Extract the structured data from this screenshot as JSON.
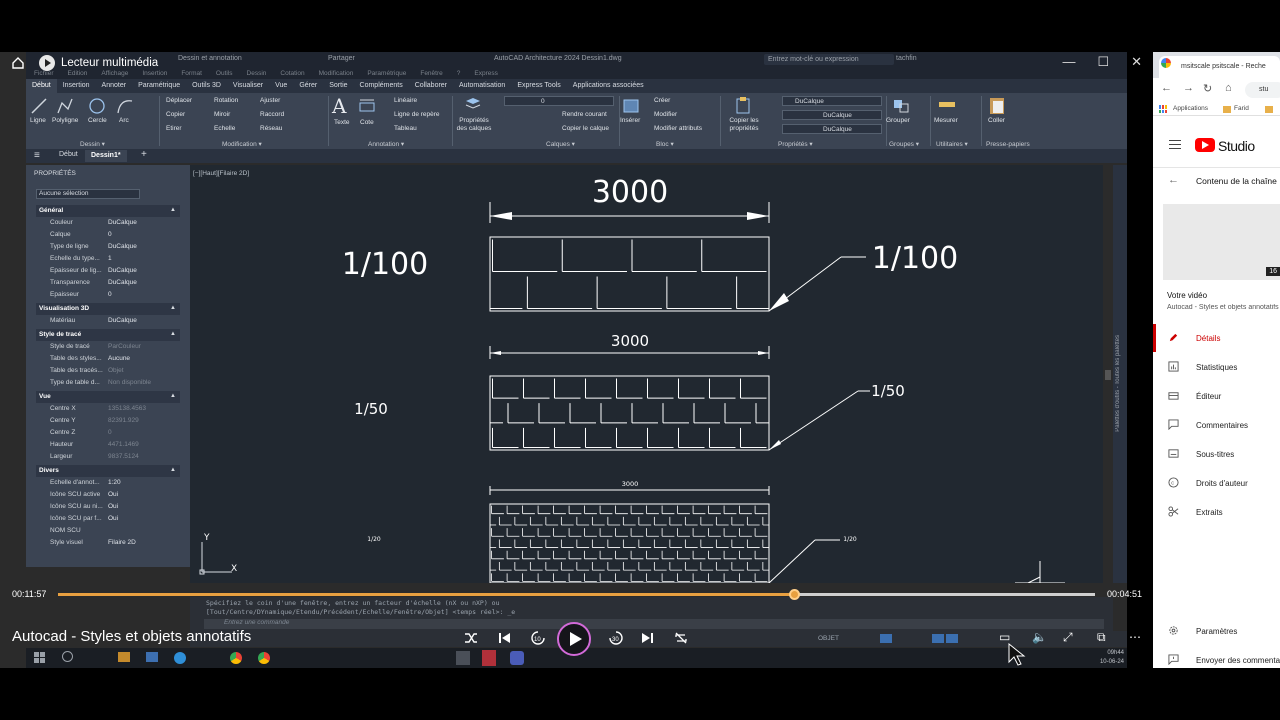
{
  "player": {
    "app_title": "Lecteur multimédia",
    "video_title": "Autocad - Styles et objets annotatifs",
    "time_current": "00:11:57",
    "time_remaining": "00:04:51",
    "progress": 0.71,
    "colors": {
      "accent": "#e8a040",
      "ring": "#d26ad8"
    }
  },
  "autocad": {
    "window_title": "AutoCAD Architecture 2024   Dessin1.dwg",
    "workspace": "Dessin et annotation",
    "search_placeholder": "Entrez mot-clé ou expression",
    "user": "tachfin",
    "share": "Partager",
    "menu": [
      "Fichier",
      "Edition",
      "Affichage",
      "Insertion",
      "Format",
      "Outils",
      "Dessin",
      "Cotation",
      "Modification",
      "Paramétrique",
      "Fenêtre",
      "?",
      "Express"
    ],
    "ribbon_tabs": [
      "Début",
      "Insertion",
      "Annoter",
      "Paramétrique",
      "Outils 3D",
      "Visualiser",
      "Vue",
      "Gérer",
      "Sortie",
      "Compléments",
      "Collaborer",
      "Automatisation",
      "Express Tools",
      "Applications associées"
    ],
    "ribbon_groups": {
      "dessin": {
        "label": "Dessin ▾",
        "tools": [
          "Ligne",
          "Polyligne",
          "Cercle",
          "Arc"
        ]
      },
      "modification": {
        "label": "Modification ▾",
        "tools": [
          "Déplacer",
          "Rotation",
          "Ajuster",
          "Copier",
          "Miroir",
          "Raccord",
          "Etirer",
          "Echelle",
          "Réseau"
        ]
      },
      "annotation": {
        "label": "Annotation ▾",
        "tools": [
          "Texte",
          "Cote",
          "Linéaire",
          "Ligne de repère",
          "Tableau"
        ]
      },
      "calques": {
        "label": "Calques ▾",
        "tools": [
          "Propriétés des calques",
          "Rendre courant",
          "Copier le calque"
        ],
        "layer_value": "0"
      },
      "bloc": {
        "label": "Bloc ▾",
        "tools": [
          "Insérer",
          "Créer",
          "Modifier",
          "Modifier attributs"
        ]
      },
      "proprietes": {
        "label": "Propriétés ▾",
        "tools": [
          "Copier les propriétés"
        ],
        "values": [
          "DuCalque",
          "DuCalque",
          "DuCalque"
        ]
      },
      "groupes": {
        "label": "Groupes ▾",
        "tools": [
          "Grouper"
        ]
      },
      "utilitaires": {
        "label": "Utilitaires ▾",
        "tools": [
          "Mesurer"
        ]
      },
      "presse_papiers": {
        "label": "Presse-papiers",
        "tools": [
          "Coller"
        ]
      }
    },
    "doc_tabs": [
      "Début",
      "Dessin1*"
    ],
    "viewport_label": "[−][Haut][Filaire 2D]",
    "tool_palettes_label": "Palettes d'outils - Toutes les palettes",
    "command_lines": [
      "Spécifiez le coin d'une fenêtre, entrez un facteur d'échelle (nX ou nXP) ou",
      "[Tout/Centre/DYnamique/Etendu/Précédent/Echelle/Fenêtre/Objet] <temps réel>: _e"
    ],
    "command_placeholder": "Entrez une commande",
    "status_model": "OBJET",
    "clock_time": "09h44",
    "clock_date": "10-06-24"
  },
  "properties": {
    "title": "PROPRIÉTÉS",
    "selection": "Aucune sélection",
    "sections": [
      {
        "name": "Général",
        "rows": [
          [
            "Couleur",
            "DuCalque"
          ],
          [
            "Calque",
            "0"
          ],
          [
            "Type de ligne",
            "DuCalque"
          ],
          [
            "Echelle du type...",
            "1"
          ],
          [
            "Epaisseur de lig...",
            "DuCalque"
          ],
          [
            "Transparence",
            "DuCalque"
          ],
          [
            "Epaisseur",
            "0"
          ]
        ]
      },
      {
        "name": "Visualisation 3D",
        "rows": [
          [
            "Matériau",
            "DuCalque"
          ]
        ]
      },
      {
        "name": "Style de tracé",
        "rows": [
          [
            "Style de tracé",
            "ParCouleur"
          ],
          [
            "Table des styles...",
            "Aucune"
          ],
          [
            "Table des tracés...",
            "Objet"
          ],
          [
            "Type de table d...",
            "Non disponible"
          ]
        ]
      },
      {
        "name": "Vue",
        "rows": [
          [
            "Centre X",
            "135138.4563"
          ],
          [
            "Centre Y",
            "82391.929"
          ],
          [
            "Centre Z",
            "0"
          ],
          [
            "Hauteur",
            "4471.1469"
          ],
          [
            "Largeur",
            "9837.5124"
          ]
        ]
      },
      {
        "name": "Divers",
        "rows": [
          [
            "Echelle d'annot...",
            "1:20"
          ],
          [
            "Icône SCU active",
            "Oui"
          ],
          [
            "Icône SCU au ni...",
            "Oui"
          ],
          [
            "Icône SCU par f...",
            "Oui"
          ],
          [
            "NOM SCU",
            ""
          ],
          [
            "Style visuel",
            "Filaire 2D"
          ]
        ]
      }
    ]
  },
  "drawing": {
    "dim_large": "3000",
    "dim_medium": "3000",
    "dim_small": "3000",
    "scale_left_1": "1/100",
    "scale_right_1": "1/100",
    "scale_left_2": "1/50",
    "scale_right_2": "1/50",
    "scale_left_3": "1/20",
    "scale_right_3": "1/20",
    "axis_y": "Y",
    "axis_x": "X"
  },
  "browser": {
    "tab_title": "msitscale psitscale - Reche",
    "url": "stu",
    "bookmarks": [
      "Applications",
      "Farid"
    ],
    "studio_name": "Studio",
    "back_label": "Contenu de la chaîne",
    "thumb_duration": "16",
    "your_video": "Votre vidéo",
    "video_sub": "Autocad - Styles et objets annotatifs",
    "nav": [
      "Détails",
      "Statistiques",
      "Éditeur",
      "Commentaires",
      "Sous-titres",
      "Droits d'auteur",
      "Extraits"
    ],
    "bottom_nav": [
      "Paramètres",
      "Envoyer des commentaires"
    ]
  }
}
